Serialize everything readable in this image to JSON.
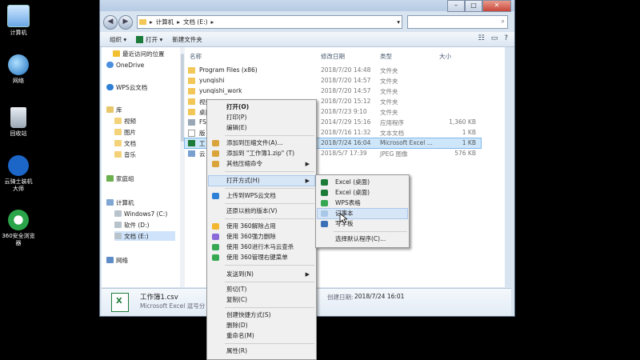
{
  "desktop": {
    "icons": [
      {
        "label": "计算机",
        "icon": "computer-icon"
      },
      {
        "label": "网络",
        "icon": "network-icon"
      },
      {
        "label": "回收站",
        "icon": "recycle-bin-icon"
      },
      {
        "label": "云骑士装机大师",
        "icon": "yunqishi-icon"
      },
      {
        "label": "360安全浏览器",
        "icon": "360-browser-icon"
      }
    ]
  },
  "window": {
    "address": {
      "parts": [
        "计算机",
        "文档 (E:)"
      ],
      "separator": "▸"
    },
    "toolbar": {
      "organize": "组织",
      "open": "打开",
      "new_folder": "新建文件夹"
    },
    "nav": {
      "items": [
        {
          "label": "最近访问的位置",
          "icon": "star-icon"
        },
        {
          "label": "OneDrive",
          "icon": "onedrive-icon"
        },
        {
          "label": "WPS云文档",
          "icon": "wps-cloud-icon"
        },
        {
          "label": "库",
          "icon": "library-icon"
        },
        {
          "label": "视频",
          "icon": "video-icon"
        },
        {
          "label": "图片",
          "icon": "picture-icon"
        },
        {
          "label": "文档",
          "icon": "document-icon"
        },
        {
          "label": "音乐",
          "icon": "music-icon"
        },
        {
          "label": "家庭组",
          "icon": "homegroup-icon"
        },
        {
          "label": "计算机",
          "icon": "computer-icon"
        },
        {
          "label": "Windows7 (C:)",
          "icon": "drive-icon"
        },
        {
          "label": "软件 (D:)",
          "icon": "drive-icon"
        },
        {
          "label": "文档 (E:)",
          "icon": "drive-icon"
        },
        {
          "label": "网络",
          "icon": "network-icon"
        }
      ]
    },
    "columns": {
      "name": "名称",
      "modified": "修改日期",
      "type": "类型",
      "size": "大小"
    },
    "files": [
      {
        "name": "Program Files (x86)",
        "modified": "2018/7/20 14:48",
        "type": "文件夹",
        "size": ""
      },
      {
        "name": "yunqishi",
        "modified": "2018/7/20 14:57",
        "type": "文件夹",
        "size": ""
      },
      {
        "name": "yunqishi_work",
        "modified": "2018/7/20 14:57",
        "type": "文件夹",
        "size": ""
      },
      {
        "name": "视频",
        "modified": "2018/7/20 15:12",
        "type": "文件夹",
        "size": ""
      },
      {
        "name": "桌面",
        "modified": "2018/7/23 9:10",
        "type": "文件夹",
        "size": ""
      },
      {
        "name": "FS",
        "modified": "2014/7/29 15:16",
        "type": "应用程序",
        "size": "1,360 KB"
      },
      {
        "name": "版",
        "modified": "2018/7/16 11:32",
        "type": "文本文档",
        "size": "1 KB"
      },
      {
        "name": "工",
        "modified": "2018/7/24 16:04",
        "type": "Microsoft Excel ...",
        "size": "1 KB"
      },
      {
        "name": "云",
        "modified": "2018/5/7 17:39",
        "type": "JPEG 图像",
        "size": "576 KB"
      }
    ],
    "details": {
      "filename": "工作簿1.csv",
      "filetype": "Microsoft Excel 逗号分",
      "created_label": "创建日期:",
      "created": "2018/7/24 16:01"
    }
  },
  "context_menu": {
    "items": [
      {
        "label": "打开(O)",
        "bold": true
      },
      {
        "label": "打印(P)"
      },
      {
        "label": "编辑(E)"
      },
      {
        "label": "添加到压缩文件(A)...",
        "icon": "zip-icon"
      },
      {
        "label": "添加到 \"工作簿1.zip\" (T)",
        "icon": "zip-icon"
      },
      {
        "label": "其他压缩命令",
        "icon": "zip-icon",
        "submenu": true
      },
      {
        "label": "打开方式(H)",
        "submenu": true,
        "highlighted": true
      },
      {
        "label": "上传到WPS云文档",
        "icon": "wps-icon"
      },
      {
        "label": "还原以前的版本(V)"
      },
      {
        "label": "使用 360解除占用",
        "icon": "360-unlock-icon"
      },
      {
        "label": "使用 360强力删除",
        "icon": "360-delete-icon"
      },
      {
        "label": "使用 360进行木马云查杀",
        "icon": "360-scan-icon"
      },
      {
        "label": "使用 360管理右键菜单",
        "icon": "360-menu-icon"
      },
      {
        "label": "发送到(N)",
        "submenu": true
      },
      {
        "label": "剪切(T)"
      },
      {
        "label": "复制(C)"
      },
      {
        "label": "创建快捷方式(S)"
      },
      {
        "label": "删除(D)"
      },
      {
        "label": "重命名(M)"
      },
      {
        "label": "属性(R)"
      }
    ]
  },
  "open_with_menu": {
    "items": [
      {
        "label": "Excel (桌面)",
        "icon": "excel-icon"
      },
      {
        "label": "Excel (桌面)",
        "icon": "excel-icon"
      },
      {
        "label": "WPS表格",
        "icon": "wps-sheet-icon"
      },
      {
        "label": "记事本",
        "icon": "notepad-icon",
        "highlighted": true
      },
      {
        "label": "写字板",
        "icon": "wordpad-icon"
      },
      {
        "label": "选择默认程序(C)..."
      }
    ]
  }
}
